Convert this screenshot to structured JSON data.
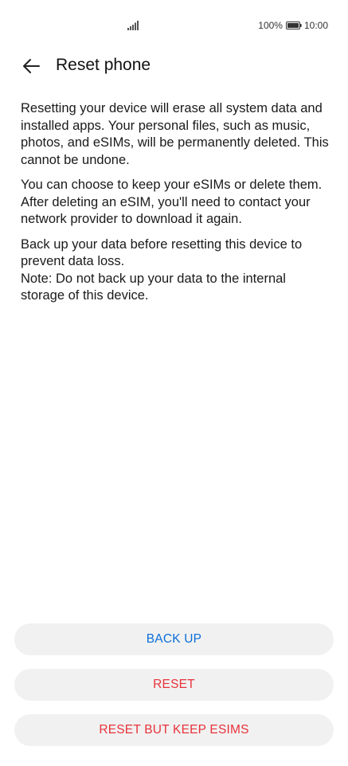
{
  "status_bar": {
    "battery_percent": "100%",
    "time": "10:00",
    "signal_icon": "signal-bars-icon",
    "battery_icon": "battery-full-icon"
  },
  "header": {
    "back_icon": "arrow-left-icon",
    "title": "Reset phone"
  },
  "content": {
    "paragraph1": "Resetting your device will erase all system data and installed apps. Your personal files, such as music, photos, and eSIMs, will be permanently deleted. This cannot be undone.",
    "paragraph2": "You can choose to keep your eSIMs or delete them. After deleting an eSIM, you'll need to contact your network provider to download it again.",
    "paragraph3": "Back up your data before resetting this device to prevent data loss.",
    "paragraph4": "Note: Do not back up your data to the internal storage of this device."
  },
  "buttons": {
    "back_up": "BACK UP",
    "reset": "RESET",
    "reset_keep_esims": "RESET BUT KEEP ESIMS"
  },
  "colors": {
    "accent_blue": "#0a6ed8",
    "danger_red": "#e8323a",
    "button_bg": "#f1f1f1"
  }
}
